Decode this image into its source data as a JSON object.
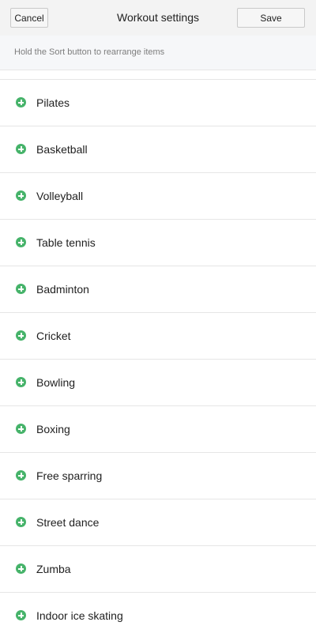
{
  "header": {
    "cancel_label": "Cancel",
    "title": "Workout settings",
    "save_label": "Save"
  },
  "hint": {
    "text": "Hold the Sort button to rearrange items"
  },
  "list": {
    "items": [
      {
        "label": "Pilates"
      },
      {
        "label": "Basketball"
      },
      {
        "label": "Volleyball"
      },
      {
        "label": "Table tennis"
      },
      {
        "label": "Badminton"
      },
      {
        "label": "Cricket"
      },
      {
        "label": "Bowling"
      },
      {
        "label": "Boxing"
      },
      {
        "label": "Free sparring"
      },
      {
        "label": "Street dance"
      },
      {
        "label": "Zumba"
      },
      {
        "label": "Indoor ice skating"
      }
    ]
  },
  "colors": {
    "accent_green": "#46b36a"
  },
  "icons": {
    "item_icon": "add-circle-icon"
  }
}
